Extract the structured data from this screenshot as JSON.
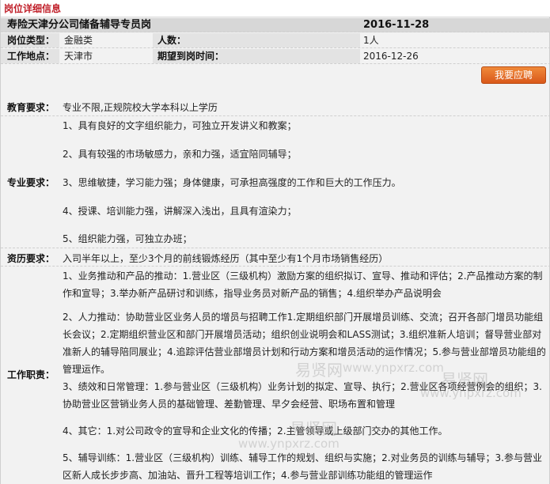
{
  "section_title": "岗位详细信息",
  "job": {
    "title": "寿险天津分公司储备辅导专员岗",
    "publish_date": "2016-11-28",
    "type_label": "岗位类型：",
    "type_value": "金融类",
    "count_label": "人数：",
    "count_value": "1人",
    "location_label": "工作地点：",
    "location_value": "天津市",
    "arrival_label": "期望到岗时间：",
    "arrival_value": "2016-12-26",
    "apply_button": "我要应聘"
  },
  "education": {
    "label": "教育要求：",
    "value": "专业不限,正规院校大学本科以上学历"
  },
  "major": {
    "label": "专业要求：",
    "items": [
      "1、具有良好的文字组织能力，可独立开发讲义和教案；",
      "2、具有较强的市场敏感力，亲和力强，适宜陪同辅导；",
      "3、思维敏捷，学习能力强；身体健康，可承担高强度的工作和巨大的工作压力。",
      "4、授课、培训能力强，讲解深入浅出，且具有渲染力；",
      "5、组织能力强，可独立办班；"
    ]
  },
  "experience": {
    "label": "资历要求：",
    "value": "入司半年以上，至少3个月的前线锻炼经历（其中至少有1个月市场销售经历）"
  },
  "duties": {
    "label": "工作职责：",
    "items": [
      "1、业务推动和产品的推动：1.营业区（三级机构）激励方案的组织拟订、宣导、推动和评估；2.产品推动方案的制作和宣导；3.举办新产品研讨和训练，指导业务员对新产品的销售；4.组织举办产品说明会",
      "2、人力推动：协助营业区业务人员的增员与招聘工作1.定期组织部门开展增员训练、交流；召开各部门增员功能组长会议；2.定期组织营业区和部门开展增员活动；组织创业说明会和LASS测试；3.组织准新人培训；督导营业部对准新人的辅导陪同展业；4.追踪评估营业部增员计划和行动方案和增员活动的运作情况；5.参与营业部增员功能组的管理运作。",
      "3、绩效和日常管理：1.参与营业区（三级机构）业务计划的拟定、宣导、执行；2.营业区各项经营例会的组织；3.协助营业区营销业务人员的基础管理、差勤管理、早夕会经营、职场布置和管理",
      "4、其它：1.对公司政令的宣导和企业文化的传播；2.主管领导或上级部门交办的其他工作。",
      "5、辅导训练：1.营业区（三级机构）训练、辅导工作的规划、组织与实施；2.对业务员的训练与辅导；3.参与营业区新人成长步步高、加油站、晋升工程等培训工作；4.参与营业部训练功能组的管理运作"
    ]
  },
  "watermarks": [
    "易贤网",
    "www.ynpxrz.com",
    "易贤网",
    "www.ynpxrz.com",
    "易贤网",
    "www.ynpxrz.com"
  ]
}
